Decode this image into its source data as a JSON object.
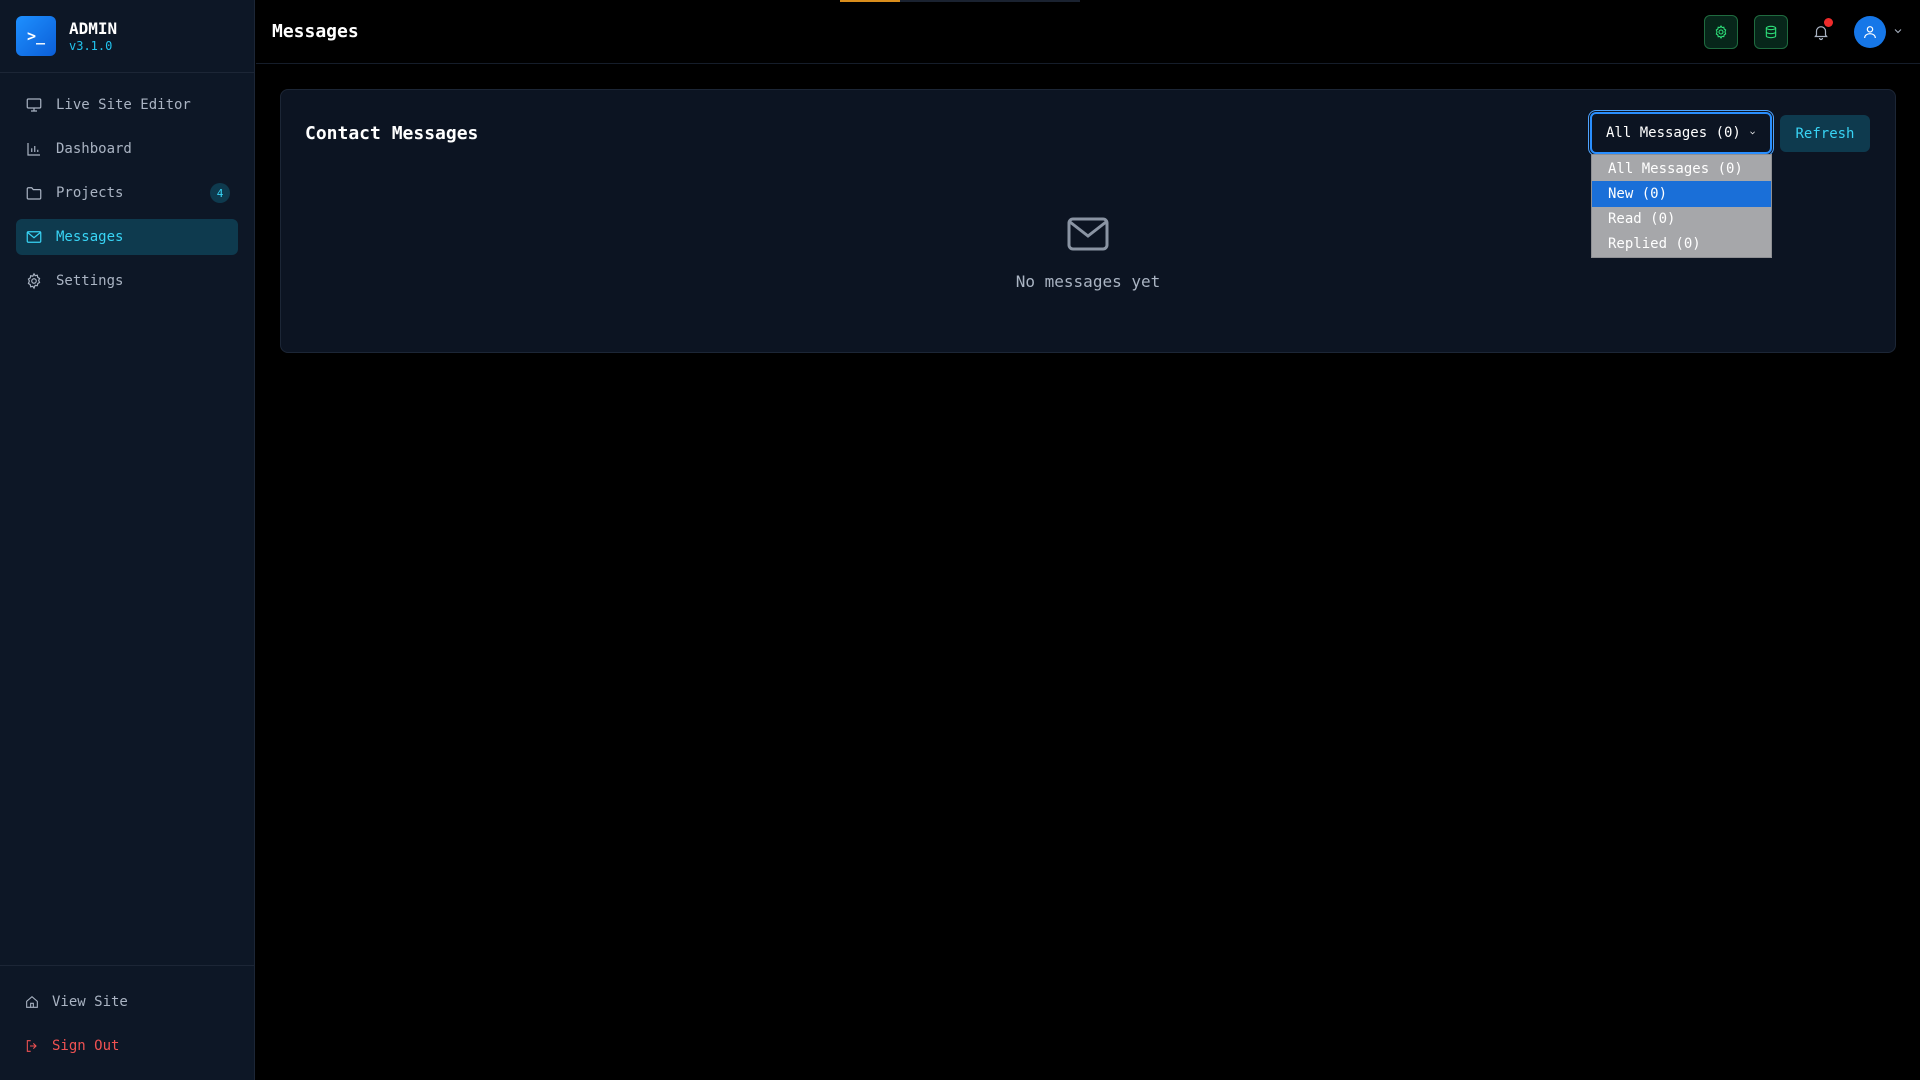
{
  "brand": {
    "logo_glyph": ">_",
    "name": "ADMIN",
    "version": "v3.1.0"
  },
  "sidebar": {
    "items": [
      {
        "label": "Live Site Editor",
        "icon": "monitor-icon"
      },
      {
        "label": "Dashboard",
        "icon": "bar-chart-icon"
      },
      {
        "label": "Projects",
        "icon": "folder-icon",
        "badge": "4"
      },
      {
        "label": "Messages",
        "icon": "mail-icon",
        "active": true
      },
      {
        "label": "Settings",
        "icon": "gear-icon"
      }
    ],
    "footer": [
      {
        "label": "View Site",
        "icon": "home-icon"
      },
      {
        "label": "Sign Out",
        "icon": "sign-out-icon"
      }
    ]
  },
  "header": {
    "title": "Messages",
    "progress": 0.25,
    "actions": [
      "settings-icon",
      "database-icon",
      "bell-icon",
      "user-icon"
    ]
  },
  "card": {
    "title": "Contact Messages",
    "filter": {
      "selected": "All Messages (0)",
      "options": [
        "All Messages (0)",
        "New (0)",
        "Read (0)",
        "Replied (0)"
      ],
      "highlighted_index": 1
    },
    "refresh_label": "Refresh",
    "empty_text": "No messages yet"
  },
  "colors": {
    "accent": "#38d4f5",
    "sidebar_bg": "#0d1726",
    "card_bg": "#0c1422",
    "danger": "#f05252",
    "green": "#2ee07a",
    "select_highlight": "#1a6fd8"
  }
}
